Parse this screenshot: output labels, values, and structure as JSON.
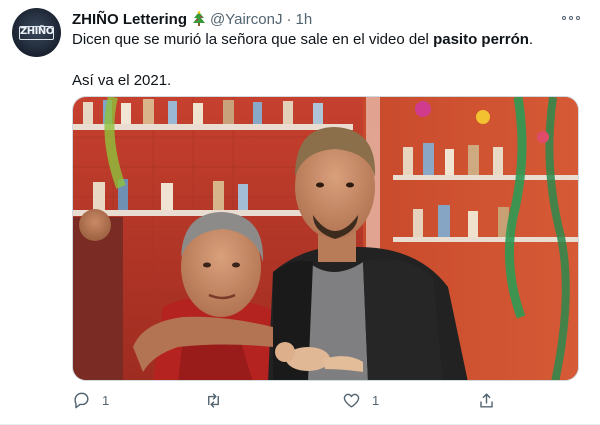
{
  "author": {
    "display_name": "ZHIÑO Lettering",
    "emoji_icon": "christmas-tree-icon",
    "handle": "@YairconJ",
    "separator": "·",
    "time": "1h",
    "avatar_text": "ZHIÑO"
  },
  "tweet": {
    "line1_pre": "Dicen que se murió la señora que sale en el video del ",
    "line1_bold": "pasito perrón",
    "line1_post": ".",
    "line2": "Así va el 2021."
  },
  "actions": {
    "reply_count": "1",
    "retweet_count": "",
    "like_count": "1",
    "share_count": ""
  },
  "colors": {
    "text": "#0f1419",
    "secondary": "#536471",
    "border": "#cfd9de"
  }
}
